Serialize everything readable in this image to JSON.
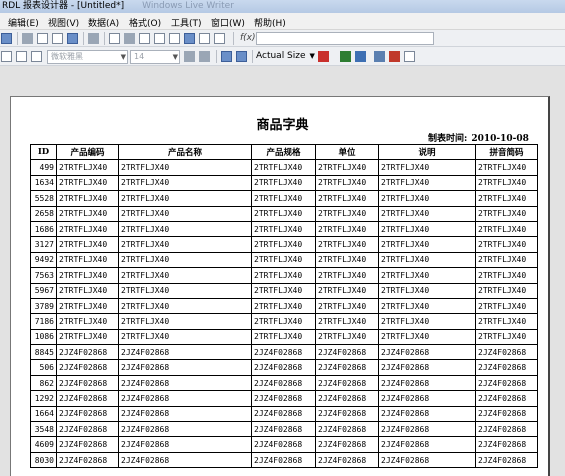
{
  "window": {
    "title": "RDL 报表设计器 - [Untitled*]",
    "ghost_title": "Windows Live Writer"
  },
  "menu": [
    {
      "label": "编辑(E)",
      "name": "menu-edit"
    },
    {
      "label": "视图(V)",
      "name": "menu-view"
    },
    {
      "label": "数据(A)",
      "name": "menu-data"
    },
    {
      "label": "格式(O)",
      "name": "menu-format"
    },
    {
      "label": "工具(T)",
      "name": "menu-tools"
    },
    {
      "label": "窗口(W)",
      "name": "menu-window"
    },
    {
      "label": "帮助(H)",
      "name": "menu-help"
    }
  ],
  "toolbar": {
    "fx_label": "f(x)",
    "font_name": "微软雅黑",
    "font_size": "14",
    "zoom": "Actual Size"
  },
  "report": {
    "title": "商品字典",
    "date_label": "制表时间:",
    "date_value": "2010-10-08",
    "columns": [
      "ID",
      "产品编码",
      "产品名称",
      "产品规格",
      "单位",
      "说明",
      "拼音简码"
    ],
    "rows": [
      [
        "499",
        "2TRTFLJX40",
        "2TRTFLJX40",
        "2TRTFLJX40",
        "2TRTFLJX40",
        "2TRTFLJX40",
        "2TRTFLJX40"
      ],
      [
        "1634",
        "2TRTFLJX40",
        "2TRTFLJX40",
        "2TRTFLJX40",
        "2TRTFLJX40",
        "2TRTFLJX40",
        "2TRTFLJX40"
      ],
      [
        "5528",
        "2TRTFLJX40",
        "2TRTFLJX40",
        "2TRTFLJX40",
        "2TRTFLJX40",
        "2TRTFLJX40",
        "2TRTFLJX40"
      ],
      [
        "2658",
        "2TRTFLJX40",
        "2TRTFLJX40",
        "2TRTFLJX40",
        "2TRTFLJX40",
        "2TRTFLJX40",
        "2TRTFLJX40"
      ],
      [
        "1686",
        "2TRTFLJX40",
        "2TRTFLJX40",
        "2TRTFLJX40",
        "2TRTFLJX40",
        "2TRTFLJX40",
        "2TRTFLJX40"
      ],
      [
        "3127",
        "2TRTFLJX40",
        "2TRTFLJX40",
        "2TRTFLJX40",
        "2TRTFLJX40",
        "2TRTFLJX40",
        "2TRTFLJX40"
      ],
      [
        "9492",
        "2TRTFLJX40",
        "2TRTFLJX40",
        "2TRTFLJX40",
        "2TRTFLJX40",
        "2TRTFLJX40",
        "2TRTFLJX40"
      ],
      [
        "7563",
        "2TRTFLJX40",
        "2TRTFLJX40",
        "2TRTFLJX40",
        "2TRTFLJX40",
        "2TRTFLJX40",
        "2TRTFLJX40"
      ],
      [
        "5967",
        "2TRTFLJX40",
        "2TRTFLJX40",
        "2TRTFLJX40",
        "2TRTFLJX40",
        "2TRTFLJX40",
        "2TRTFLJX40"
      ],
      [
        "3789",
        "2TRTFLJX40",
        "2TRTFLJX40",
        "2TRTFLJX40",
        "2TRTFLJX40",
        "2TRTFLJX40",
        "2TRTFLJX40"
      ],
      [
        "7186",
        "2TRTFLJX40",
        "2TRTFLJX40",
        "2TRTFLJX40",
        "2TRTFLJX40",
        "2TRTFLJX40",
        "2TRTFLJX40"
      ],
      [
        "1086",
        "2TRTFLJX40",
        "2TRTFLJX40",
        "2TRTFLJX40",
        "2TRTFLJX40",
        "2TRTFLJX40",
        "2TRTFLJX40"
      ],
      [
        "8845",
        "2JZ4F02868",
        "2JZ4F02868",
        "2JZ4F02868",
        "2JZ4F02868",
        "2JZ4F02868",
        "2JZ4F02868"
      ],
      [
        "506",
        "2JZ4F02868",
        "2JZ4F02868",
        "2JZ4F02868",
        "2JZ4F02868",
        "2JZ4F02868",
        "2JZ4F02868"
      ],
      [
        "862",
        "2JZ4F02868",
        "2JZ4F02868",
        "2JZ4F02868",
        "2JZ4F02868",
        "2JZ4F02868",
        "2JZ4F02868"
      ],
      [
        "1292",
        "2JZ4F02868",
        "2JZ4F02868",
        "2JZ4F02868",
        "2JZ4F02868",
        "2JZ4F02868",
        "2JZ4F02868"
      ],
      [
        "1664",
        "2JZ4F02868",
        "2JZ4F02868",
        "2JZ4F02868",
        "2JZ4F02868",
        "2JZ4F02868",
        "2JZ4F02868"
      ],
      [
        "3548",
        "2JZ4F02868",
        "2JZ4F02868",
        "2JZ4F02868",
        "2JZ4F02868",
        "2JZ4F02868",
        "2JZ4F02868"
      ],
      [
        "4609",
        "2JZ4F02868",
        "2JZ4F02868",
        "2JZ4F02868",
        "2JZ4F02868",
        "2JZ4F02868",
        "2JZ4F02868"
      ],
      [
        "8030",
        "2JZ4F02868",
        "2JZ4F02868",
        "2JZ4F02868",
        "2JZ4F02868",
        "2JZ4F02868",
        "2JZ4F02868"
      ]
    ]
  }
}
